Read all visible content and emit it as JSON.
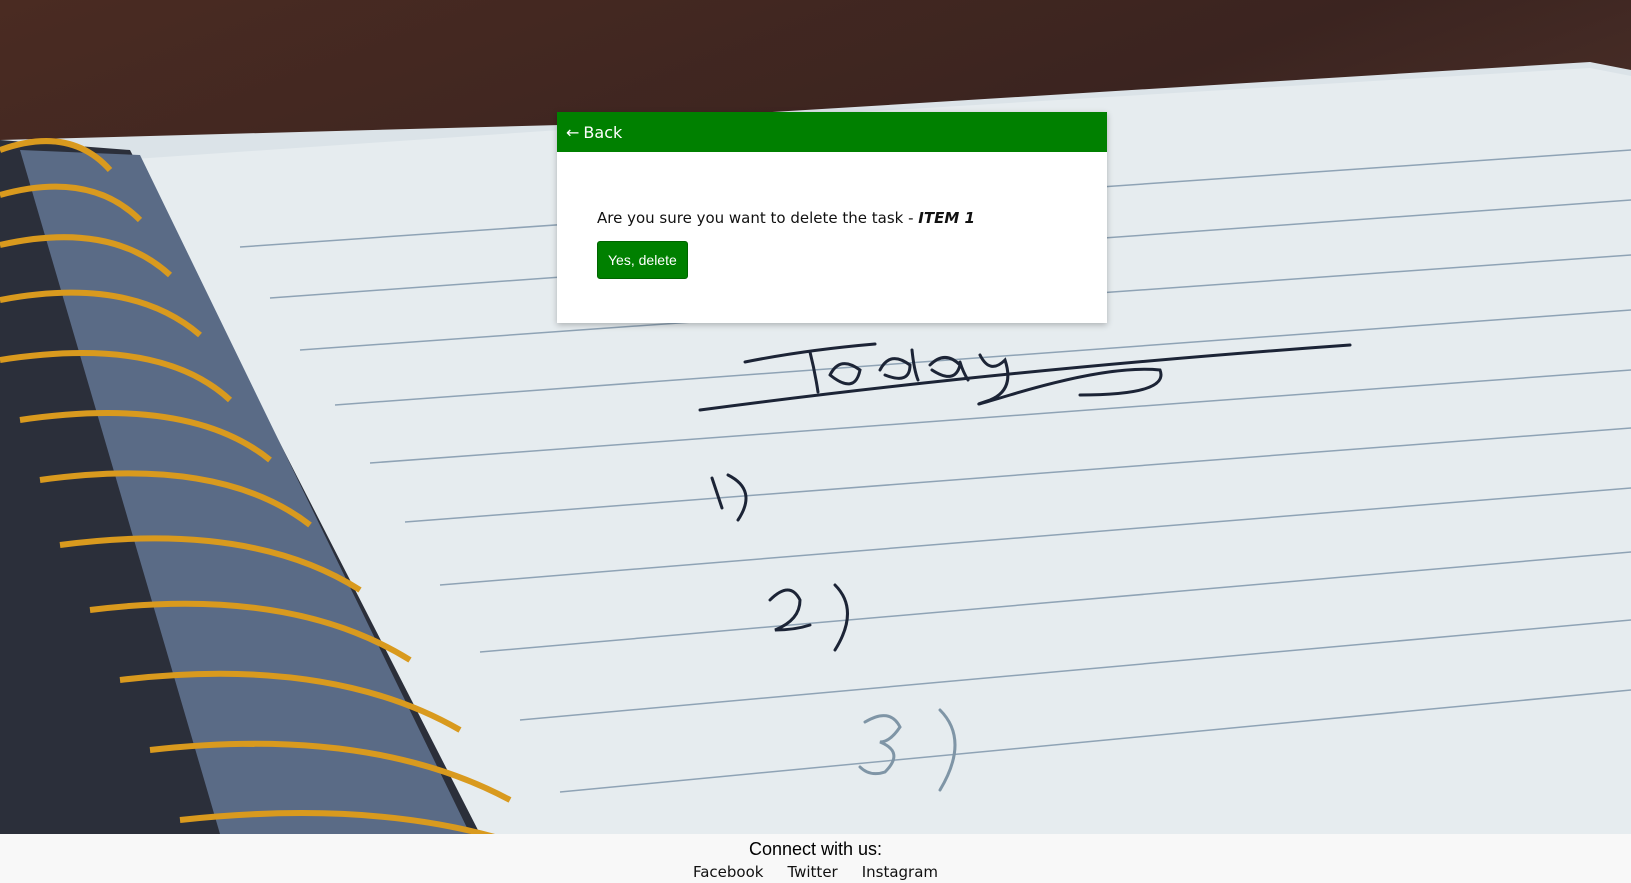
{
  "header": {
    "back_arrow": "←",
    "back_label": "Back",
    "color": "#008000"
  },
  "dialog": {
    "question": "Are you sure you want to delete the task - ",
    "task_name": "ITEM 1",
    "confirm_label": "Yes, delete"
  },
  "footer": {
    "title": "Connect with us:",
    "links": [
      {
        "label": "Facebook"
      },
      {
        "label": "Twitter"
      },
      {
        "label": "Instagram"
      }
    ]
  },
  "background": {
    "description_icon": "notebook-photo"
  }
}
